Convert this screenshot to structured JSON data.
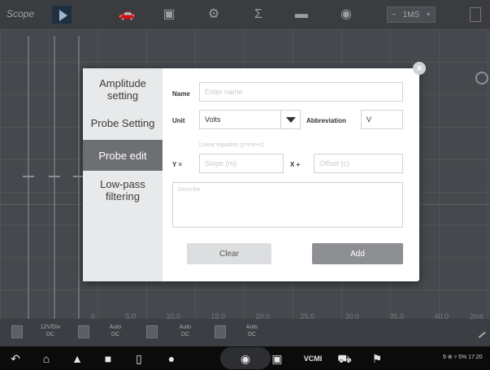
{
  "toolbar": {
    "title": "Scope",
    "timebase": "1MS",
    "timebase_minus": "−",
    "timebase_plus": "+"
  },
  "scope": {
    "scale_labels": [
      "0",
      "5.0",
      "10.0",
      "15.0",
      "20.0",
      "25.0",
      "30.0",
      "35.0",
      "40.0"
    ],
    "right_unit": "2ms"
  },
  "channels": [
    {
      "label": "12V/Div\nDC"
    },
    {
      "label": "Auto\nDC"
    },
    {
      "label": "Auto\nDC"
    },
    {
      "label": "Auto\nDC"
    }
  ],
  "dialog": {
    "side_menu": [
      {
        "label": "Amplitude setting"
      },
      {
        "label": "Probe Setting"
      },
      {
        "label": "Probe edit"
      },
      {
        "label": "Low-pass filtering"
      }
    ],
    "name_label": "Name",
    "name_placeholder": "Enter name",
    "unit_label": "Unit",
    "unit_value": "Volts",
    "abbreviation_label": "Abbreviation",
    "abbreviation_value": "V",
    "equation_hint": "Linear equation (y=mx+c)",
    "y_label": "Y =",
    "slope_placeholder": "Slope (m)",
    "x_plus_label": "X +",
    "offset_placeholder": "Offset (c)",
    "describe_placeholder": "Describe",
    "clear_button": "Clear",
    "add_button": "Add"
  },
  "navbar": {
    "vcmi_label": "VCMI",
    "status_text": "9 ⊕ ▿ 5% 17:20"
  }
}
